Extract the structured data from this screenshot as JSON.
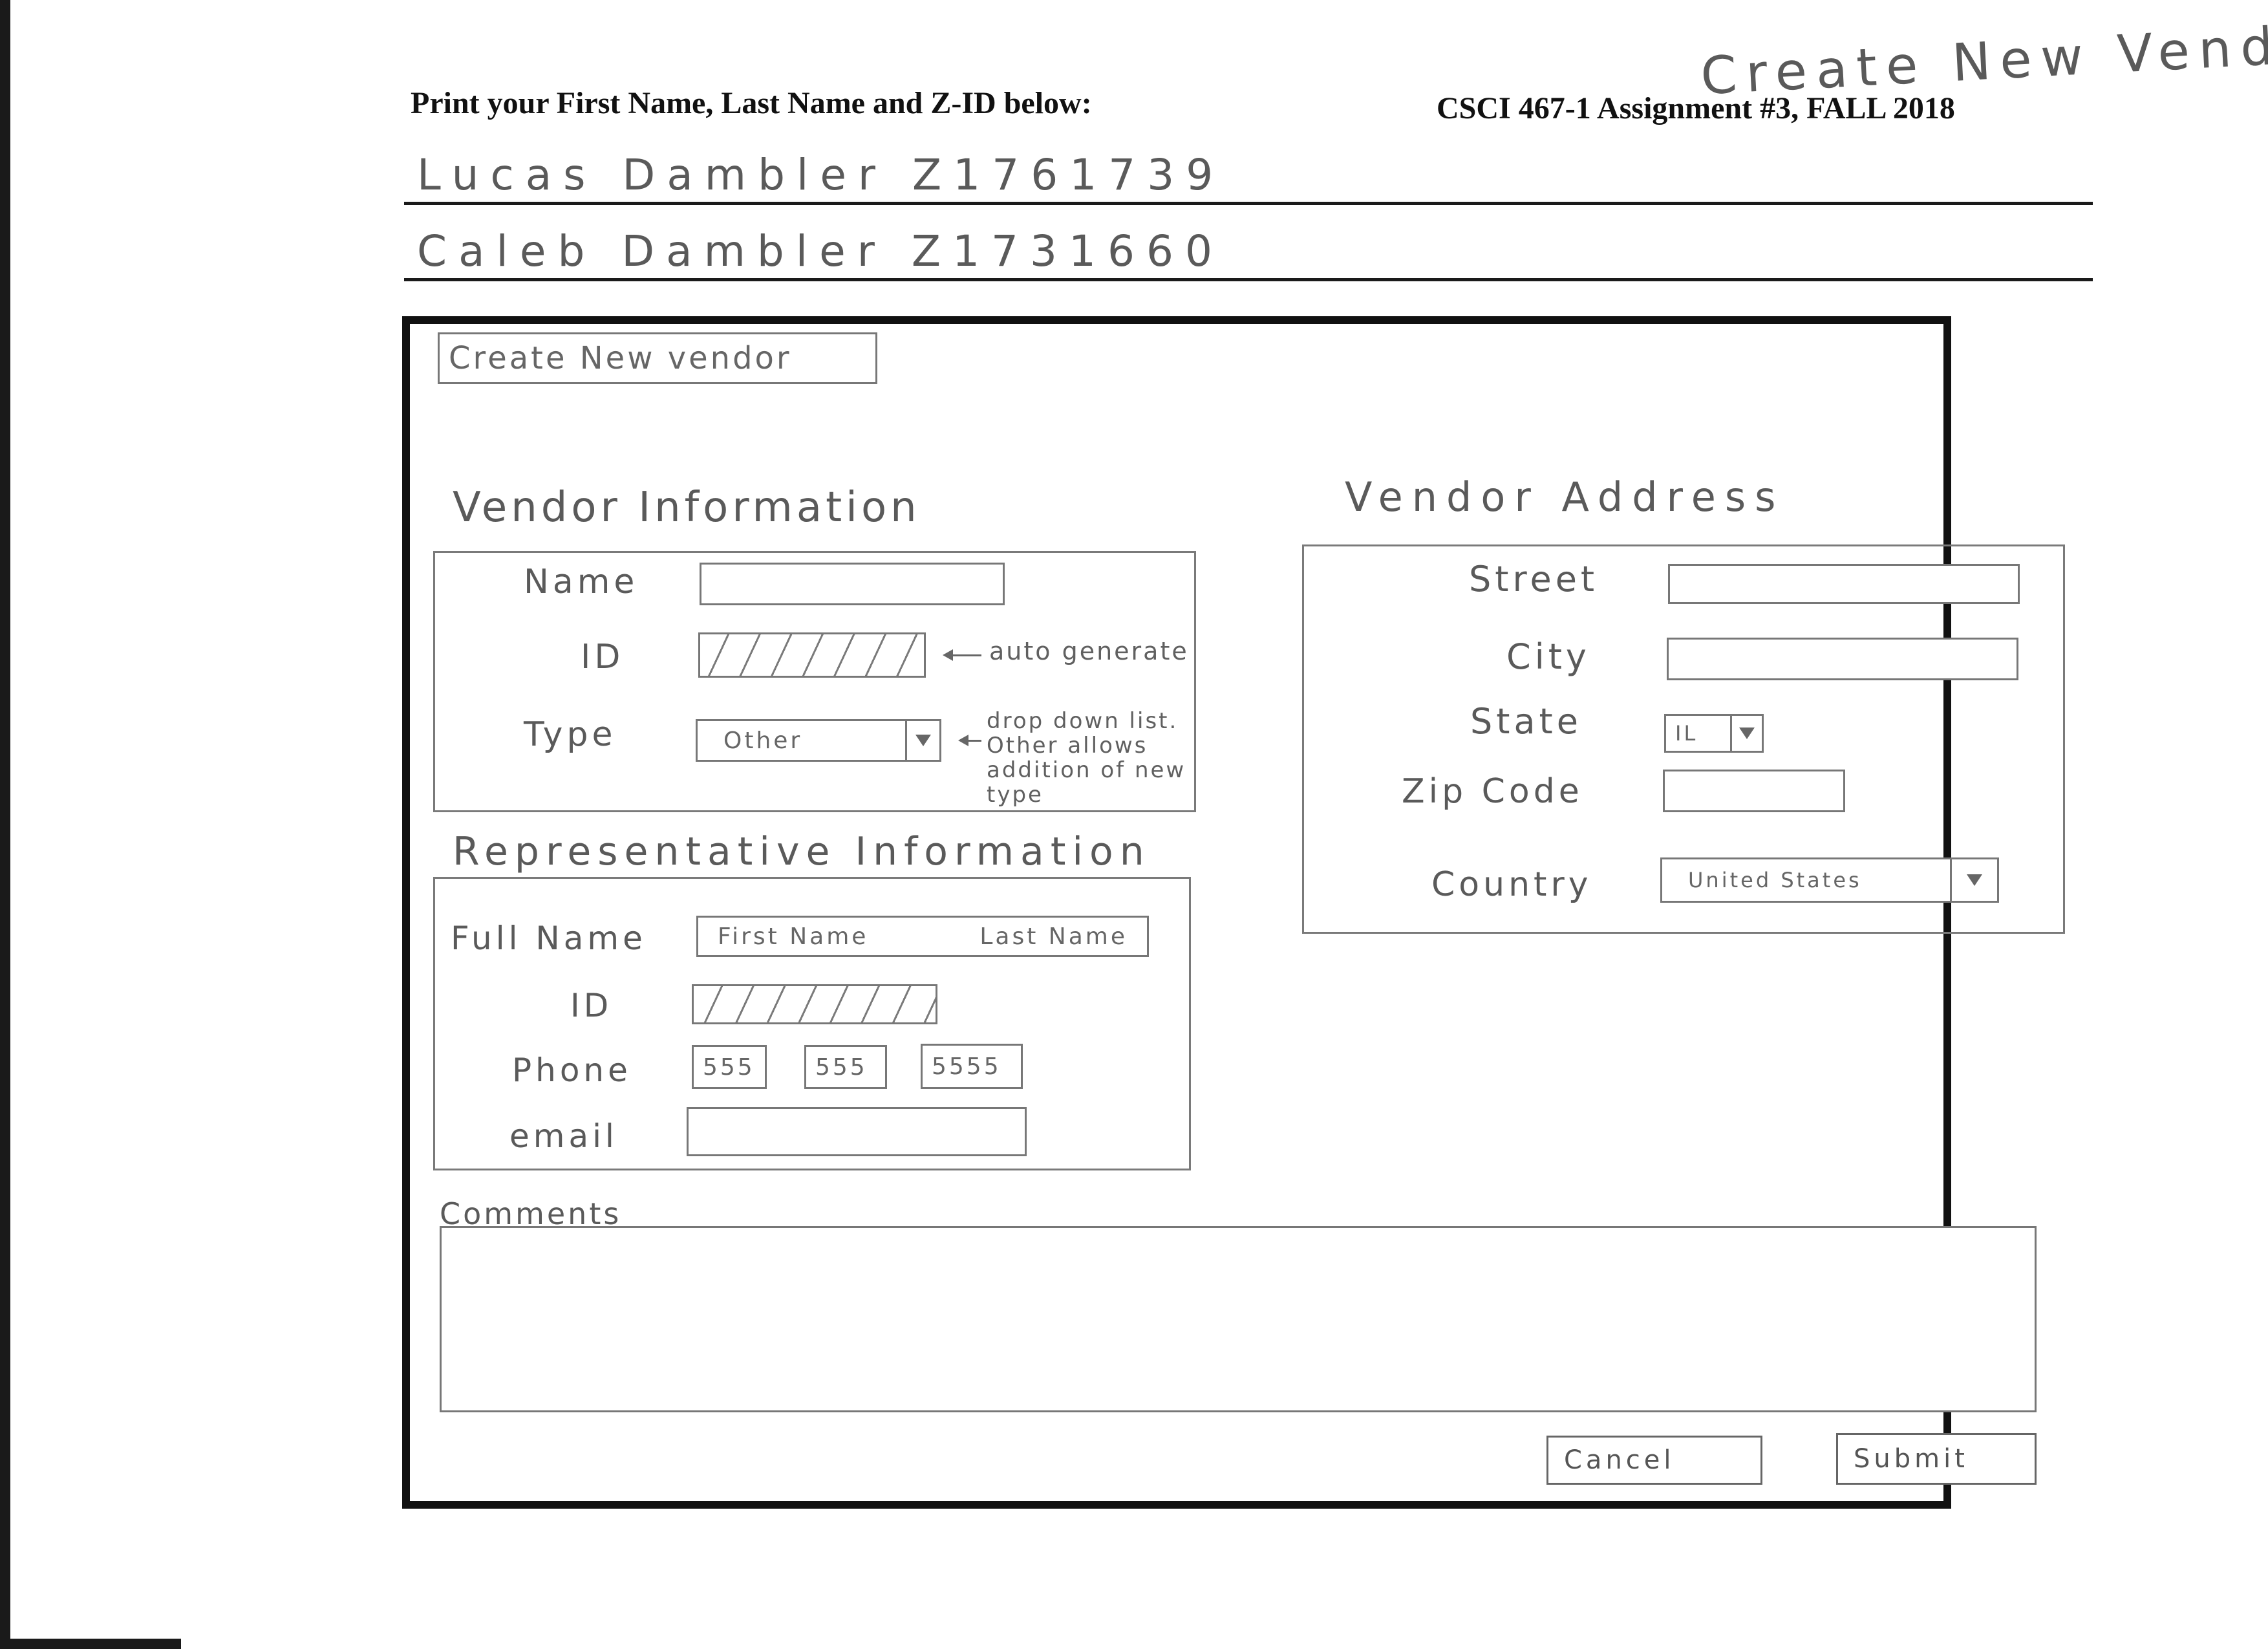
{
  "header": {
    "instruction": "Print your First Name, Last Name and Z-ID below:",
    "course": "CSCI 467-1 Assignment #3, FALL 2018",
    "corner_title": "Create New Vendor",
    "student_1": "Lucas Dambler Z1761739",
    "student_2": "Caleb Dambler Z1731660"
  },
  "window": {
    "title_button": "Create New vendor"
  },
  "vendor_info": {
    "heading": "Vendor Information",
    "name_label": "Name",
    "name_value": "",
    "id_label": "ID",
    "id_note": "auto generate",
    "type_label": "Type",
    "type_value": "Other",
    "type_note": "drop down list. Other allows addition of new type"
  },
  "rep_info": {
    "heading": "Representative Information",
    "fullname_label": "Full Name",
    "first_placeholder": "First Name",
    "last_placeholder": "Last Name",
    "id_label": "ID",
    "phone_label": "Phone",
    "phone_1": "555",
    "phone_2": "555",
    "phone_3": "5555",
    "email_label": "email",
    "email_value": ""
  },
  "vendor_address": {
    "heading": "Vendor Address",
    "street_label": "Street",
    "street_value": "",
    "city_label": "City",
    "city_value": "",
    "state_label": "State",
    "state_value": "IL",
    "zip_label": "Zip Code",
    "zip_value": "",
    "country_label": "Country",
    "country_value": "United States"
  },
  "comments": {
    "label": "Comments",
    "value": ""
  },
  "actions": {
    "cancel": "Cancel",
    "submit": "Submit"
  }
}
